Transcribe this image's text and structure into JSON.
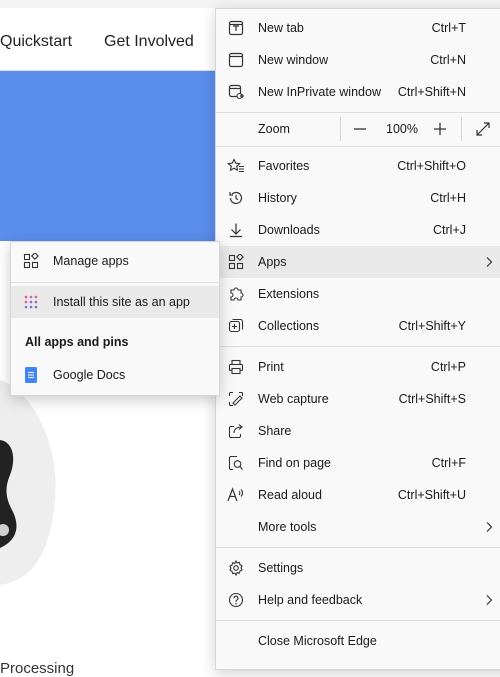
{
  "site": {
    "nav": [
      "Quickstart",
      "Get Involved"
    ],
    "bottom_text": "Processing"
  },
  "menu": {
    "items_top": [
      {
        "label": "New tab",
        "shortcut": "Ctrl+T",
        "icon": "new-tab-icon"
      },
      {
        "label": "New window",
        "shortcut": "Ctrl+N",
        "icon": "new-window-icon"
      },
      {
        "label": "New InPrivate window",
        "shortcut": "Ctrl+Shift+N",
        "icon": "inprivate-icon"
      }
    ],
    "zoom": {
      "label": "Zoom",
      "value": "100%",
      "minus": "—",
      "plus": "+"
    },
    "items_mid": [
      {
        "label": "Favorites",
        "shortcut": "Ctrl+Shift+O",
        "icon": "favorites-icon"
      },
      {
        "label": "History",
        "shortcut": "Ctrl+H",
        "icon": "history-icon"
      },
      {
        "label": "Downloads",
        "shortcut": "Ctrl+J",
        "icon": "downloads-icon"
      },
      {
        "label": "Apps",
        "shortcut": "",
        "icon": "apps-icon"
      },
      {
        "label": "Extensions",
        "shortcut": "",
        "icon": "extensions-icon"
      },
      {
        "label": "Collections",
        "shortcut": "Ctrl+Shift+Y",
        "icon": "collections-icon"
      }
    ],
    "items_tools": [
      {
        "label": "Print",
        "shortcut": "Ctrl+P",
        "icon": "print-icon"
      },
      {
        "label": "Web capture",
        "shortcut": "Ctrl+Shift+S",
        "icon": "web-capture-icon"
      },
      {
        "label": "Share",
        "shortcut": "",
        "icon": "share-icon"
      },
      {
        "label": "Find on page",
        "shortcut": "Ctrl+F",
        "icon": "find-icon"
      },
      {
        "label": "Read aloud",
        "shortcut": "Ctrl+Shift+U",
        "icon": "read-aloud-icon"
      },
      {
        "label": "More tools",
        "shortcut": "",
        "icon": ""
      }
    ],
    "items_settings": [
      {
        "label": "Settings",
        "icon": "settings-icon"
      },
      {
        "label": "Help and feedback",
        "icon": "help-icon"
      }
    ],
    "close": {
      "label": "Close Microsoft Edge"
    }
  },
  "submenu": {
    "manage_apps": "Manage apps",
    "install_site": "Install this site as an app",
    "heading": "All apps and pins",
    "apps": [
      {
        "label": "Google Docs",
        "color": "#4285f4"
      }
    ]
  }
}
